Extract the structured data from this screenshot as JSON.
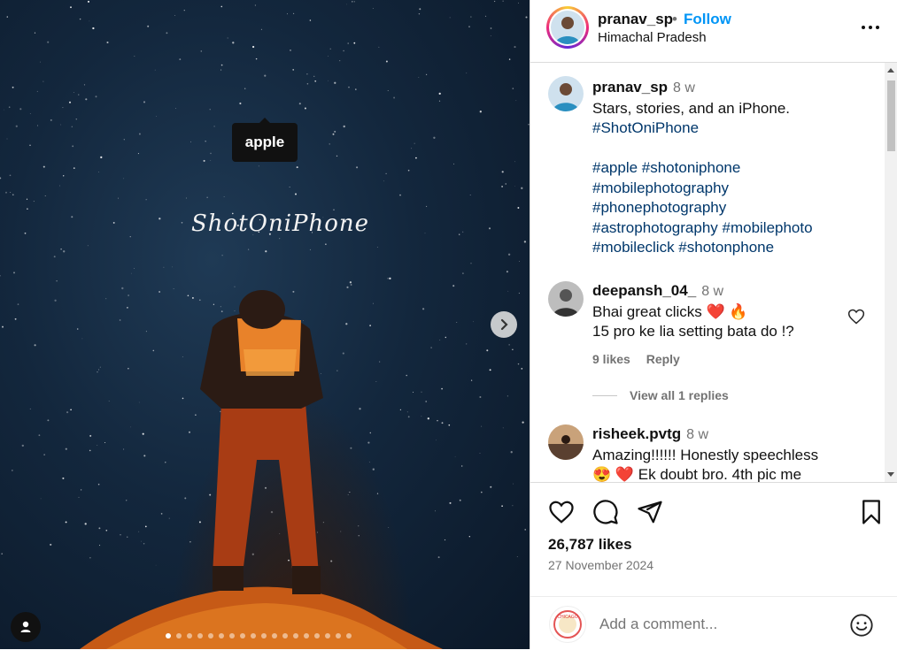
{
  "media": {
    "tag_label": "apple",
    "overlay_text": "ShotOniPhone",
    "slide_count": 18,
    "active_slide": 1
  },
  "header": {
    "username": "pranav_sp",
    "separator": "•",
    "follow_label": "Follow",
    "location": "Himachal Pradesh"
  },
  "caption": {
    "username": "pranav_sp",
    "time": "8 w",
    "text": "Stars, stories, and an iPhone.",
    "hashtag_line1": "#ShotOniPhone",
    "hashtags": [
      "#apple #shotoniphone",
      "#mobilephotography",
      "#phonephotography",
      "#astrophotography #mobilephoto",
      "#mobileclick #shotonphone"
    ]
  },
  "comments": [
    {
      "username": "deepansh_04_",
      "time": "8 w",
      "line1": "Bhai great clicks ❤️ 🔥",
      "line2": "15 pro ke lia setting bata do !?",
      "likes": "9 likes",
      "reply_label": "Reply"
    },
    {
      "username": "risheek.pvtg",
      "time": "8 w",
      "line1": "Amazing!!!!!! Honestly speechless",
      "line2": "😍 ❤️  Ek doubt bro. 4th pic me"
    }
  ],
  "view_replies": "View all 1 replies",
  "post": {
    "likes": "26,787 likes",
    "date": "27 November 2024"
  },
  "add_comment": {
    "placeholder": "Add a comment...",
    "avatar_text": "CHICAGO"
  },
  "icons": {
    "like": "heart-icon",
    "comment": "comment-icon",
    "share": "share-icon",
    "save": "bookmark-icon",
    "more": "more-icon",
    "next": "chevron-right-icon",
    "emoji": "emoji-icon",
    "tagged_users": "user-icon"
  },
  "colors": {
    "follow": "#0095f6",
    "hashtag": "#00376b",
    "muted": "#737373"
  }
}
